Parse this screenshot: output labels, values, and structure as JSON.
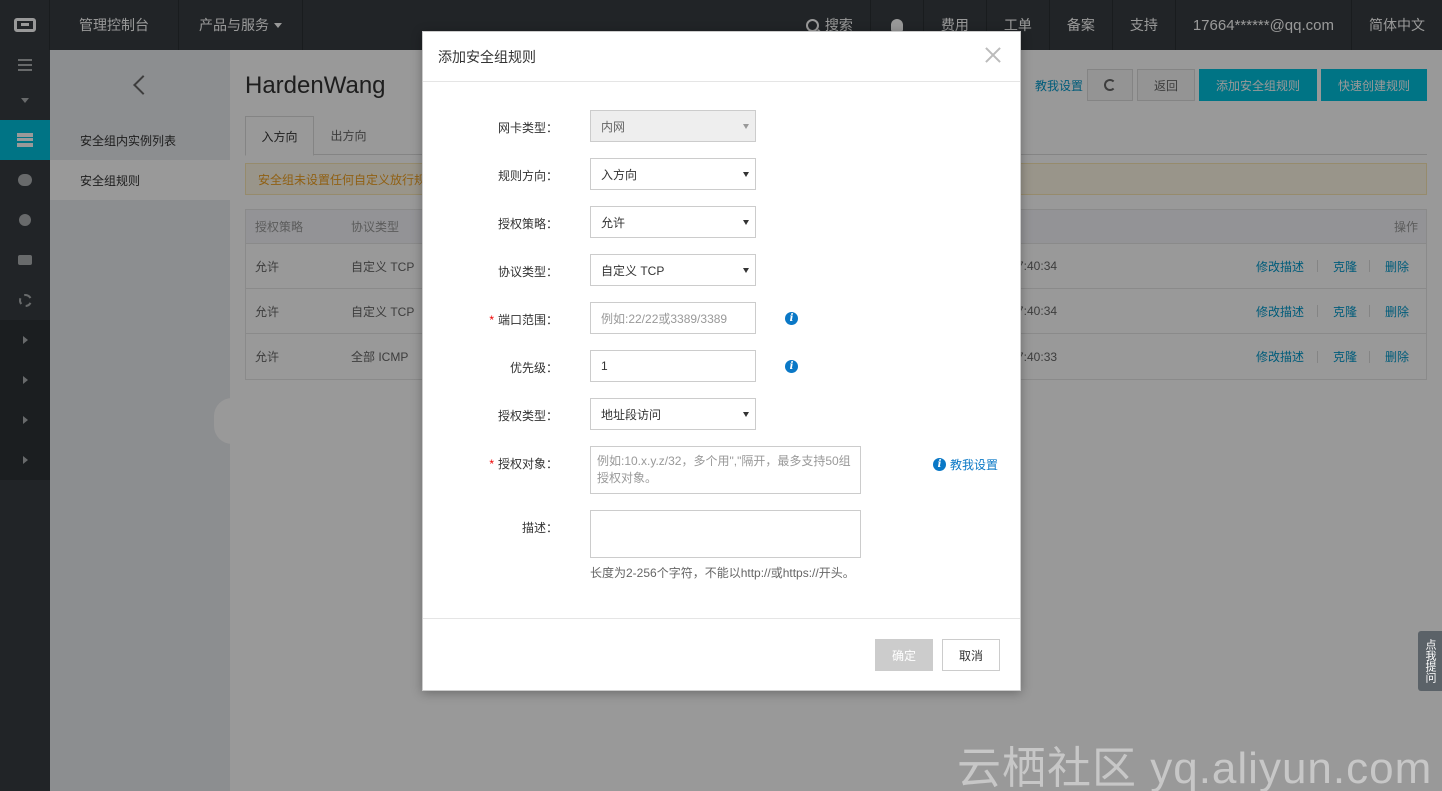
{
  "topbar": {
    "console": "管理控制台",
    "products": "产品与服务",
    "search": "搜索",
    "fees": "费用",
    "tickets": "工单",
    "icp": "备案",
    "support": "支持",
    "account": "17664******@qq.com",
    "language": "简体中文"
  },
  "sidebar": {
    "items": [
      {
        "label": "安全组内实例列表"
      },
      {
        "label": "安全组规则"
      }
    ]
  },
  "main": {
    "title": "HardenWang",
    "help_link": "教我设置",
    "back_btn": "返回",
    "add_rule_btn": "添加安全组规则",
    "quick_create_btn": "快速创建规则",
    "tabs": [
      {
        "label": "入方向"
      },
      {
        "label": "出方向"
      }
    ],
    "notice": "安全组未设置任何自定义放行规",
    "table": {
      "headers": {
        "policy": "授权策略",
        "protocol": "协议类型",
        "ops": "操作"
      },
      "rows": [
        {
          "policy": "允许",
          "protocol": "自定义 TCP",
          "time": "7:40:34",
          "edit": "修改描述",
          "clone": "克隆",
          "delete": "删除"
        },
        {
          "policy": "允许",
          "protocol": "自定义 TCP",
          "time": "7:40:34",
          "edit": "修改描述",
          "clone": "克隆",
          "delete": "删除"
        },
        {
          "policy": "允许",
          "protocol": "全部 ICMP",
          "time": "7:40:33",
          "edit": "修改描述",
          "clone": "克隆",
          "delete": "删除"
        }
      ]
    }
  },
  "dialog": {
    "title": "添加安全组规则",
    "fields": {
      "nic_type": {
        "label": "网卡类型：",
        "value": "内网"
      },
      "direction": {
        "label": "规则方向：",
        "value": "入方向"
      },
      "policy": {
        "label": "授权策略：",
        "value": "允许"
      },
      "protocol": {
        "label": "协议类型：",
        "value": "自定义 TCP"
      },
      "port_range": {
        "label": "端口范围：",
        "placeholder": "例如:22/22或3389/3389",
        "required": "*"
      },
      "priority": {
        "label": "优先级：",
        "value": "1"
      },
      "auth_type": {
        "label": "授权类型：",
        "value": "地址段访问"
      },
      "auth_object": {
        "label": "授权对象：",
        "placeholder": "例如:10.x.y.z/32，多个用\",\"隔开，最多支持50组授权对象。",
        "required": "*"
      },
      "description": {
        "label": "描述：",
        "hint": "长度为2-256个字符，不能以http://或https://开头。"
      }
    },
    "help_link": "教我设置",
    "confirm": "确定",
    "cancel": "取消"
  },
  "floating_tab": "点我提问",
  "watermark": "云栖社区 yq.aliyun.com"
}
